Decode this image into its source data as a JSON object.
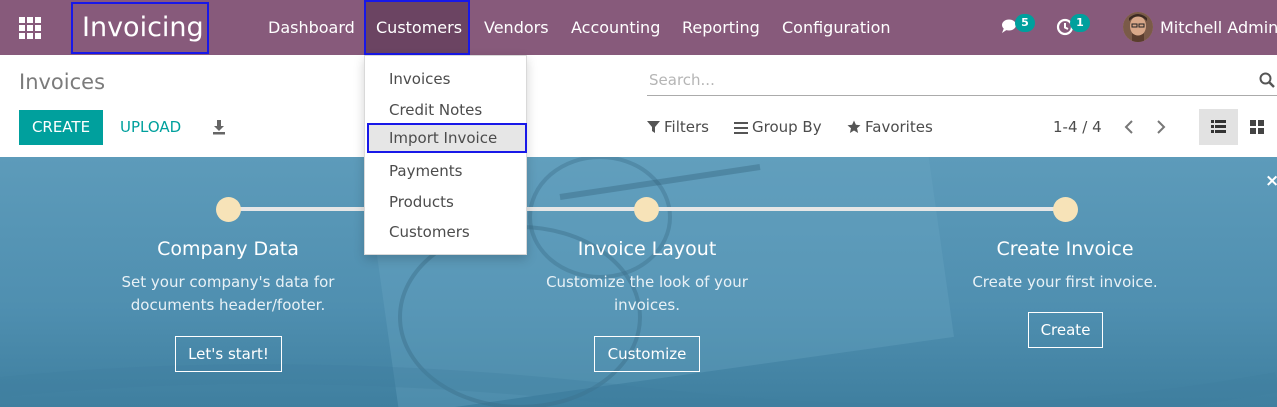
{
  "navbar": {
    "app_title": "Invoicing",
    "menu": [
      "Dashboard",
      "Customers",
      "Vendors",
      "Accounting",
      "Reporting",
      "Configuration"
    ],
    "messages_count": "5",
    "activities_count": "1",
    "user_name": "Mitchell Admin",
    "bg_color": "#875a7b"
  },
  "dropdown": {
    "items": [
      "Invoices",
      "Credit Notes",
      "Import Invoice",
      "Payments",
      "Products",
      "Customers"
    ],
    "highlighted": "Import Invoice"
  },
  "control_panel": {
    "title": "Invoices",
    "create_label": "CREATE",
    "upload_label": "UPLOAD",
    "search_placeholder": "Search...",
    "filters_label": "Filters",
    "group_by_label": "Group By",
    "favorites_label": "Favorites",
    "pager": "1-4 / 4",
    "accent_color": "#00a09d"
  },
  "banner": {
    "close_label": "×",
    "steps": [
      {
        "title": "Company Data",
        "desc_line1": "Set your company's data for",
        "desc_line2": "documents header/footer.",
        "button": "Let's start!"
      },
      {
        "title": "Invoice Layout",
        "desc_line1": "Customize the look of your",
        "desc_line2": "invoices.",
        "button": "Customize"
      },
      {
        "title": "Create Invoice",
        "desc_line1": "Create your first invoice.",
        "desc_line2": "",
        "button": "Create"
      }
    ]
  },
  "icons": [
    "apps-grid-icon",
    "chat-icon",
    "clock-icon",
    "download-icon",
    "search-icon",
    "filter-icon",
    "group-by-icon",
    "star-icon",
    "chevron-left-icon",
    "chevron-right-icon",
    "list-view-icon",
    "kanban-view-icon"
  ]
}
